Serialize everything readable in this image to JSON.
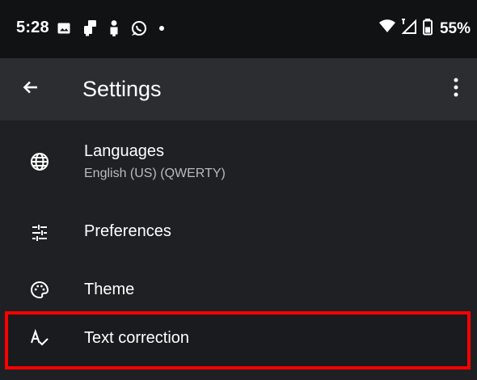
{
  "status_bar": {
    "time": "5:28",
    "battery": "55%",
    "icons": [
      "image-icon",
      "notification-card-icon",
      "person-icon",
      "whatsapp-icon",
      "dot-icon",
      "wifi-icon",
      "signal-icon",
      "battery-icon"
    ]
  },
  "toolbar": {
    "title": "Settings",
    "back_icon": "arrow-left-icon",
    "overflow_icon": "more-vertical-icon"
  },
  "settings": [
    {
      "label": "Languages",
      "sublabel": "English (US) (QWERTY)",
      "icon": "globe-icon"
    },
    {
      "label": "Preferences",
      "icon": "sliders-icon"
    },
    {
      "label": "Theme",
      "icon": "palette-icon"
    },
    {
      "label": "Text correction",
      "icon": "spellcheck-icon"
    }
  ],
  "colors": {
    "background": "#1f2023",
    "status_bar": "#111214",
    "toolbar": "#2c2d31",
    "highlight_border": "#ff0000",
    "text_primary": "#ffffff",
    "text_secondary": "#b9bbc0"
  }
}
